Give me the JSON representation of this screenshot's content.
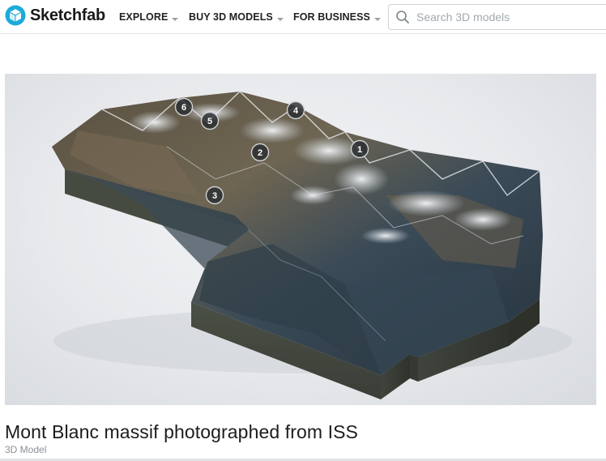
{
  "brand": {
    "name": "Sketchfab",
    "logo_icon": "sketchfab-cube-icon",
    "accent_color": "#1caad9"
  },
  "nav": {
    "items": [
      {
        "label": "EXPLORE",
        "icon": "chevron-down-icon"
      },
      {
        "label": "BUY 3D MODELS",
        "icon": "chevron-down-icon"
      },
      {
        "label": "FOR BUSINESS",
        "icon": "chevron-down-icon"
      }
    ]
  },
  "search": {
    "placeholder": "Search 3D models",
    "value": "",
    "icon": "search-icon"
  },
  "viewer": {
    "hotspots": [
      {
        "label": "1"
      },
      {
        "label": "2"
      },
      {
        "label": "3"
      },
      {
        "label": "4"
      },
      {
        "label": "5"
      },
      {
        "label": "6"
      }
    ]
  },
  "model": {
    "title": "Mont Blanc massif photographed from ISS",
    "type": "3D Model"
  }
}
